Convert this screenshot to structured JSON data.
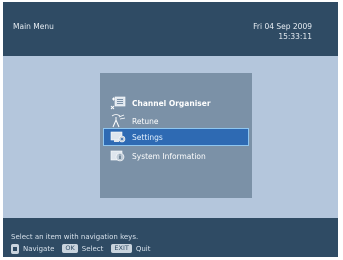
{
  "header": {
    "title": "Main Menu",
    "date": "Fri   04 Sep 2009",
    "time": "15:33:11"
  },
  "menu": {
    "items": [
      {
        "label": "Channel Organiser",
        "icon": "channel-organiser-icon"
      },
      {
        "label": "Retune",
        "icon": "retune-icon"
      },
      {
        "label": "Settings",
        "icon": "settings-icon",
        "selected": true
      },
      {
        "label": "System Information",
        "icon": "system-information-icon"
      }
    ]
  },
  "footer": {
    "hint": "Select an item with navigation keys.",
    "navigate_label": "Navigate",
    "ok_key": "OK",
    "select_label": "Select",
    "exit_key": "EXIT",
    "quit_label": "Quit"
  },
  "colors": {
    "bar": "#2f4b64",
    "background": "#b4c6dc",
    "panel": "#7b91a7",
    "selection": "#2e6ab3"
  }
}
